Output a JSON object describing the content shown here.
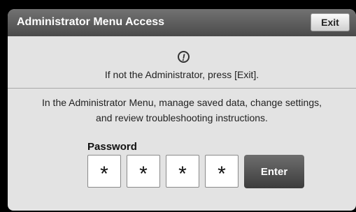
{
  "dialog": {
    "title": "Administrator Menu Access",
    "exit_label": "Exit",
    "notice_icon": "exclamation-circle-icon",
    "notice": "If not the Administrator, press [Exit].",
    "description_line1": "In the Administrator Menu, manage saved data, change settings,",
    "description_line2": "and review troubleshooting instructions.",
    "password": {
      "label": "Password",
      "digits": [
        "*",
        "*",
        "*",
        "*"
      ]
    },
    "enter_label": "Enter"
  }
}
